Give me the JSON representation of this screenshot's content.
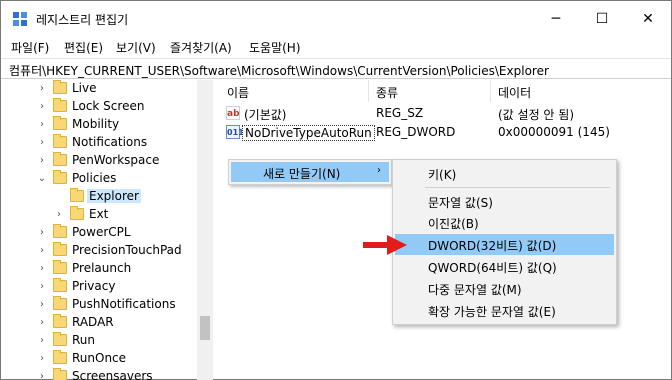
{
  "window": {
    "title": "레지스트리 편집기",
    "minimize": "─",
    "maximize": "☐",
    "close": "✕"
  },
  "menu": [
    {
      "label": "파일(F)"
    },
    {
      "label": "편집(E)"
    },
    {
      "label": "보기(V)"
    },
    {
      "label": "즐겨찾기(A)"
    },
    {
      "label": "도움말(H)"
    }
  ],
  "address": "컴퓨터\\HKEY_CURRENT_USER\\Software\\Microsoft\\Windows\\CurrentVersion\\Policies\\Explorer",
  "tree": [
    {
      "label": "Live",
      "expanded": false,
      "selected": false
    },
    {
      "label": "Lock Screen",
      "expanded": false,
      "selected": false
    },
    {
      "label": "Mobility",
      "expanded": false,
      "selected": false
    },
    {
      "label": "Notifications",
      "expanded": false,
      "selected": false
    },
    {
      "label": "PenWorkspace",
      "expanded": false,
      "selected": false
    },
    {
      "label": "Policies",
      "expanded": true,
      "selected": false
    },
    {
      "label": "Explorer",
      "expanded": false,
      "selected": true
    },
    {
      "label": "Ext",
      "expanded": false,
      "selected": false
    },
    {
      "label": "PowerCPL",
      "expanded": false,
      "selected": false
    },
    {
      "label": "PrecisionTouchPad",
      "expanded": false,
      "selected": false
    },
    {
      "label": "Prelaunch",
      "expanded": false,
      "selected": false
    },
    {
      "label": "Privacy",
      "expanded": false,
      "selected": false
    },
    {
      "label": "PushNotifications",
      "expanded": false,
      "selected": false
    },
    {
      "label": "RADAR",
      "expanded": false,
      "selected": false
    },
    {
      "label": "Run",
      "expanded": false,
      "selected": false
    },
    {
      "label": "RunOnce",
      "expanded": false,
      "selected": false
    },
    {
      "label": "Screensavers",
      "expanded": false,
      "selected": false
    }
  ],
  "columns": {
    "name": "이름",
    "type": "종류",
    "data": "데이터"
  },
  "values": [
    {
      "icon": "string-value-icon",
      "icon_text": "ab",
      "name": "(기본값)",
      "type": "REG_SZ",
      "data": "(값 설정 안 됨)"
    },
    {
      "icon": "binary-value-icon",
      "icon_text": "011",
      "name": "NoDriveTypeAutoRun",
      "type": "REG_DWORD",
      "data": "0x00000091 (145)"
    }
  ],
  "context_menu": {
    "label": "새로 만들기(N)",
    "arrow": "›"
  },
  "submenu": {
    "items": [
      {
        "label": "키(K)"
      },
      {
        "label": "문자열 값(S)"
      },
      {
        "label": "이진값(B)"
      },
      {
        "label": "DWORD(32비트) 값(D)"
      },
      {
        "label": "QWORD(64비트) 값(Q)"
      },
      {
        "label": "다중 문자열 값(M)"
      },
      {
        "label": "확장 가능한 문자열 값(E)"
      }
    ]
  },
  "colors": {
    "highlight": "#91c9f7",
    "arrow": "#e21b1b",
    "folder": "#f8d775"
  }
}
